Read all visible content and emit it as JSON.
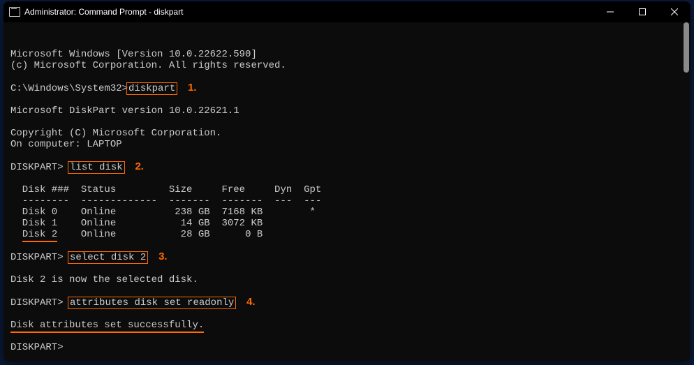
{
  "titlebar": {
    "title": "Administrator: Command Prompt - diskpart"
  },
  "terminal": {
    "ms_windows": "Microsoft Windows [Version 10.0.22622.590]",
    "copyright1": "(c) Microsoft Corporation. All rights reserved.",
    "prompt1_path": "C:\\Windows\\System32>",
    "cmd1": "diskpart",
    "step1": "1.",
    "diskpart_version": "Microsoft DiskPart version 10.0.22621.1",
    "copyright2": "Copyright (C) Microsoft Corporation.",
    "on_computer": "On computer: LAPTOP",
    "dp_prompt": "DISKPART>",
    "cmd2": "list disk",
    "step2": "2.",
    "table_header": "  Disk ###  Status         Size     Free     Dyn  Gpt",
    "table_divider": "  --------  -------------  -------  -------  ---  ---",
    "table_row0": "  Disk 0    Online          238 GB  7168 KB        *",
    "table_row1": "  Disk 1    Online           14 GB  3072 KB",
    "table_row2a": "  ",
    "table_row2_disk": "Disk 2",
    "table_row2b": "    Online           28 GB      0 B",
    "cmd3": "select disk 2",
    "step3": "3.",
    "selected_msg": "Disk 2 is now the selected disk.",
    "cmd4": "attributes disk set readonly",
    "step4": "4.",
    "success_msg": "Disk attributes set successfully.",
    "final_prompt": "DISKPART>"
  },
  "annotation_color": "#ff6a00"
}
